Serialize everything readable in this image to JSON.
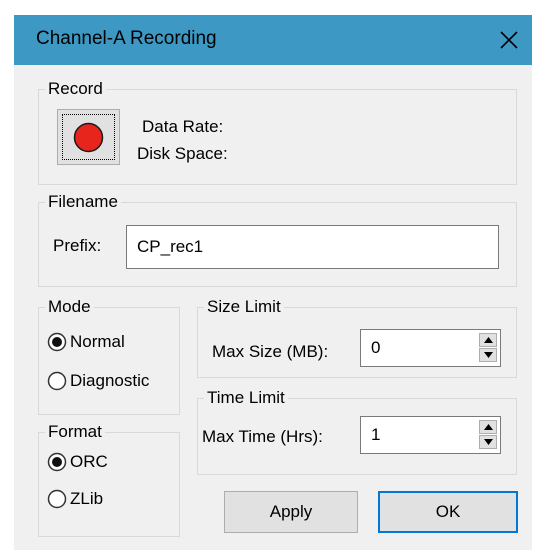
{
  "window": {
    "title": "Channel-A Recording",
    "close_icon": "close-icon"
  },
  "record": {
    "group_label": "Record",
    "button_icon": "record-red-dot-icon",
    "data_rate_label": "Data Rate:",
    "disk_space_label": "Disk Space:"
  },
  "filename": {
    "group_label": "Filename",
    "prefix_label": "Prefix:",
    "prefix_value": "CP_rec1"
  },
  "mode": {
    "group_label": "Mode",
    "options": [
      {
        "label": "Normal",
        "selected": true
      },
      {
        "label": "Diagnostic",
        "selected": false
      }
    ]
  },
  "size_limit": {
    "group_label": "Size Limit",
    "max_size_label": "Max Size (MB):",
    "max_size_value": "0"
  },
  "time_limit": {
    "group_label": "Time Limit",
    "max_time_label": "Max Time (Hrs):",
    "max_time_value": "1"
  },
  "format": {
    "group_label": "Format",
    "options": [
      {
        "label": "ORC",
        "selected": true
      },
      {
        "label": "ZLib",
        "selected": false
      }
    ]
  },
  "buttons": {
    "apply_label": "Apply",
    "ok_label": "OK"
  },
  "colors": {
    "titlebar": "#3d98c4",
    "record_dot": "#e8251c",
    "default_button_border": "#0078d7",
    "dialog_background": "#f0f0f0"
  }
}
